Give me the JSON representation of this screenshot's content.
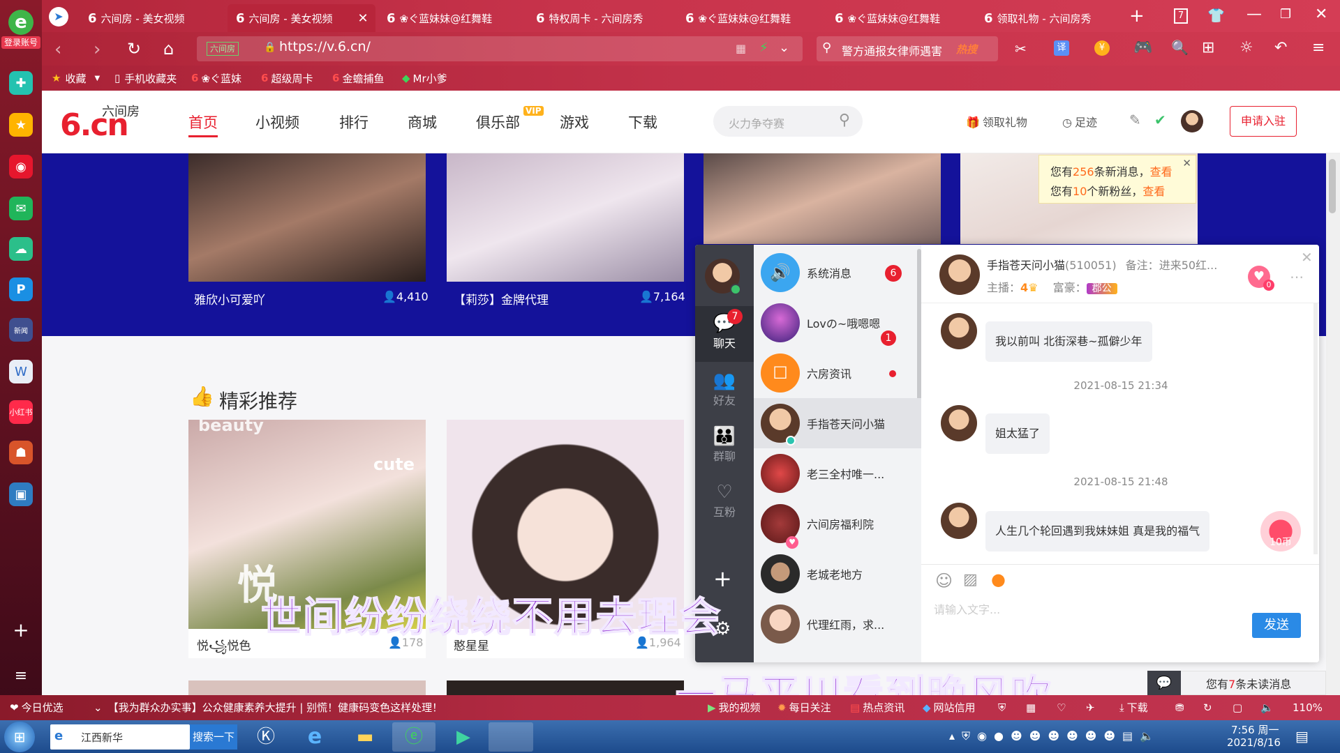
{
  "browser": {
    "left_rail": {
      "account_label": "登录账号"
    },
    "tabs": [
      {
        "label": "六间房 - 美女视频",
        "active": false
      },
      {
        "label": "六间房 - 美女视频",
        "active": true
      },
      {
        "label": "❀ぐ蓝妹妹@红舞鞋",
        "active": false
      },
      {
        "label": "特权周卡 - 六间房秀",
        "active": false
      },
      {
        "label": "❀ぐ蓝妹妹@红舞鞋",
        "active": false
      },
      {
        "label": "❀ぐ蓝妹妹@红舞鞋",
        "active": false
      },
      {
        "label": "领取礼物 - 六间房秀",
        "active": false
      }
    ],
    "tab_count": "7",
    "address": {
      "url": "https://v.6.cn/",
      "site_badge": "六间房"
    },
    "search": {
      "hot_query": "警方通报女律师遇害",
      "hot_tag": "热搜"
    },
    "bookmarks": [
      {
        "label": "收藏"
      },
      {
        "label": "手机收藏夹"
      },
      {
        "label": "❀ぐ蓝妹"
      },
      {
        "label": "超级周卡"
      },
      {
        "label": "金蟾捕鱼"
      },
      {
        "label": "Mr小爹"
      }
    ]
  },
  "site": {
    "logo": {
      "main": "6.cn",
      "sub": "六间房"
    },
    "nav": [
      {
        "label": "首页",
        "active": true
      },
      {
        "label": "小视频",
        "active": false
      },
      {
        "label": "排行",
        "active": false
      },
      {
        "label": "商城",
        "active": false
      },
      {
        "label": "俱乐部",
        "active": false,
        "badge": "VIP"
      },
      {
        "label": "游戏",
        "active": false
      },
      {
        "label": "下载",
        "active": false
      }
    ],
    "search_placeholder": "火力争夺赛",
    "header_actions": {
      "gift": "领取礼物",
      "history": "足迹",
      "apply": "申请入驻"
    },
    "live_cards": [
      {
        "title": "雅欣小可爱吖",
        "viewers": "4,410"
      },
      {
        "title": "【莉莎】金牌代理",
        "viewers": "7,164"
      }
    ],
    "notice": {
      "line1_prefix": "您有",
      "line1_count": "256",
      "line1_suffix": "条新消息，",
      "line1_link": "查看",
      "line2_prefix": "您有",
      "line2_count": "10",
      "line2_suffix": "个新粉丝，",
      "line2_link": "查看"
    },
    "section_title": "精彩推荐",
    "recommend_cards": [
      {
        "title": "悦꧁悦色",
        "viewers": "178",
        "overlay": "cute",
        "overlay2": "beauty",
        "overlay3": "悦"
      },
      {
        "title": "憨星星",
        "viewers": "1,964"
      }
    ],
    "unread_bar": {
      "prefix": "您有",
      "count": "7",
      "suffix": "条未读消息"
    }
  },
  "chat": {
    "rail": [
      {
        "label": "聊天",
        "badge": "7",
        "active": true
      },
      {
        "label": "好友",
        "active": false
      },
      {
        "label": "群聊",
        "active": false
      },
      {
        "label": "互粉",
        "active": false
      }
    ],
    "conversations": [
      {
        "name": "系统消息",
        "badge": "6",
        "color": "#3ba6f0"
      },
      {
        "name": "Lovの~哦嗯嗯",
        "badge": "1",
        "color": "#7a3a9a"
      },
      {
        "name": "六房资讯",
        "badge": "dot",
        "color": "#ff8a1c"
      },
      {
        "name": "手指苍天问小猫",
        "badge": "",
        "color": "#d9a07a",
        "selected": true
      },
      {
        "name": "老三全村唯一...",
        "badge": "",
        "color": "#b0332e"
      },
      {
        "name": "六间房福利院",
        "badge": "",
        "color": "#8a2b2b"
      },
      {
        "name": "老城老地方",
        "badge": "",
        "color": "#3b3b3b"
      },
      {
        "name": "代理红雨，求...",
        "badge": "",
        "color": "#e9b9a0"
      }
    ],
    "header": {
      "name": "手指苍天问小猫",
      "id": "(510051)",
      "remark_label": "备注：",
      "remark": "进来50红...",
      "anchor_label": "主播：",
      "anchor_level": "4",
      "rich_label": "富豪：",
      "rich_title": "郡公",
      "heart_count": "0"
    },
    "messages": [
      {
        "type": "msg",
        "text": "我以前叫 北街深巷~孤僻少年"
      },
      {
        "type": "time",
        "text": "2021-08-15 21:34"
      },
      {
        "type": "msg",
        "text": "姐太猛了"
      },
      {
        "type": "time",
        "text": "2021-08-15 21:48"
      },
      {
        "type": "msg",
        "text": "人生几个轮回遇到我妹妹姐 真是我的福气"
      }
    ],
    "coin_label": "10币",
    "input_placeholder": "请输入文字...",
    "send_label": "发送"
  },
  "lyrics": {
    "line1": "世间纷纷绕绕不用去理会",
    "line2": "一马平川看到晚风吹"
  },
  "status_bar": {
    "today": "今日优选",
    "headline": "【我为群众办实事】公众健康素养大提升 | 别慌！健康码变色这样处理！",
    "items": [
      "我的视频",
      "每日关注",
      "热点资讯",
      "网站信用"
    ],
    "download": "下载",
    "zoom": "110%"
  },
  "taskbar": {
    "search_text": "江西新华",
    "search_button": "搜索一下",
    "time": "7:56 周一",
    "date": "2021/8/16"
  }
}
